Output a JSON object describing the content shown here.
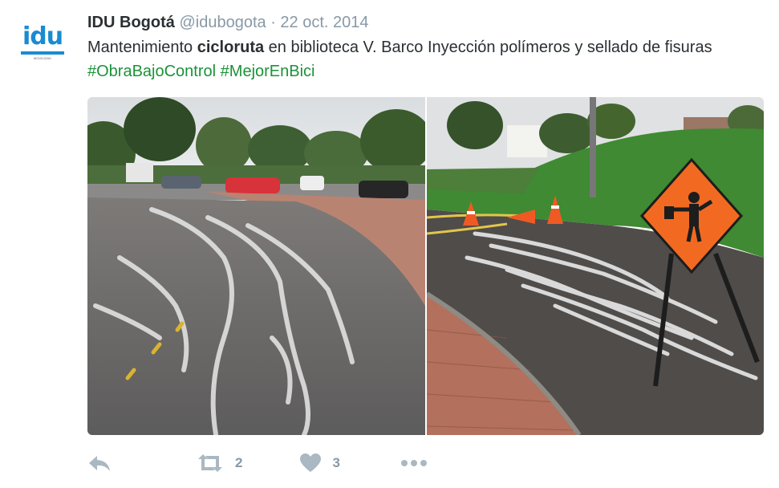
{
  "tweet": {
    "author": {
      "fullname": "IDU Bogotá",
      "screen_name": "@idubogota",
      "avatar_text": "idu",
      "avatar_subtext": "MOVILIDAD"
    },
    "separator": "·",
    "date": "22 oct. 2014",
    "text": {
      "before": "Mantenimiento ",
      "bold": "cicloruta",
      "after": " en biblioteca V. Barco Inyección polímeros y sellado de fisuras ",
      "hashtags": [
        "#ObraBajoControl",
        "#MejorEnBici"
      ]
    },
    "media": [
      {
        "icon": "photo-bike-path-crack-sealing"
      },
      {
        "icon": "photo-work-zone-sign-cones"
      }
    ],
    "actions": {
      "reply": {
        "icon": "reply-icon"
      },
      "retweet": {
        "icon": "retweet-icon",
        "count": "2"
      },
      "like": {
        "icon": "heart-icon",
        "count": "3"
      },
      "more": {
        "icon": "more-icon"
      }
    },
    "colors": {
      "hashtag": "#1b9338",
      "muted": "#8899a6",
      "text": "#292f33",
      "action_icon": "#aab8c2",
      "logo": "#1a8bd1"
    }
  }
}
